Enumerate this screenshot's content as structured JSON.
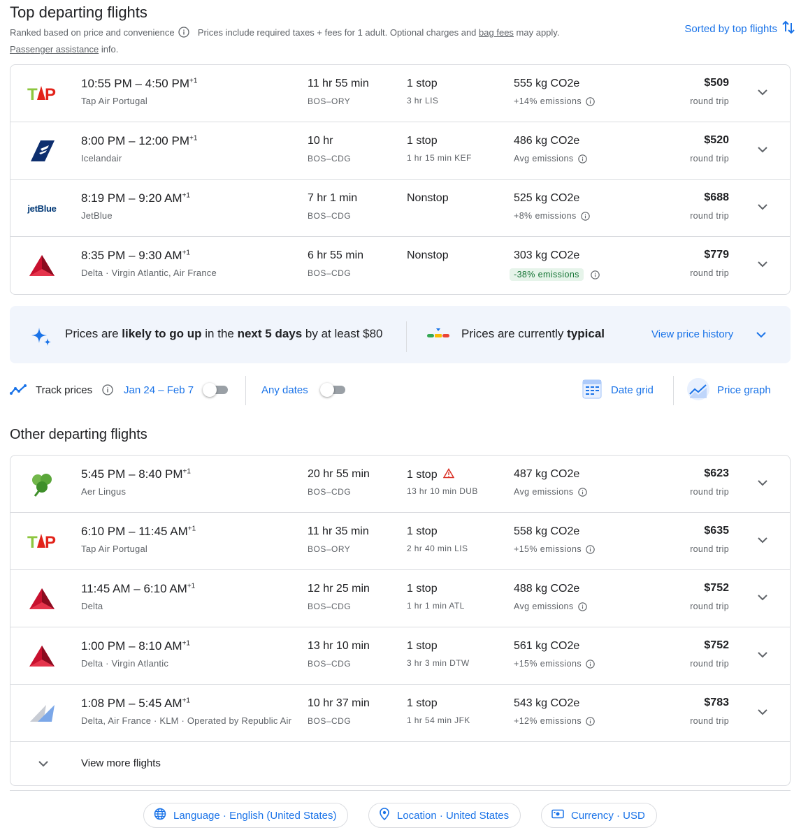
{
  "top": {
    "title": "Top departing flights",
    "ranked_text": "Ranked based on price and convenience",
    "prices_text": "Prices include required taxes + fees for 1 adult. Optional charges and",
    "bag_fees": "bag fees",
    "may_apply": "may apply.",
    "passenger_assistance": "Passenger assistance",
    "info_text": "info.",
    "sort_label": "Sorted by top flights"
  },
  "top_flights": [
    {
      "logo": "tap",
      "times": "10:55 PM – 4:50 PM",
      "plus": "+1",
      "airline": "Tap Air Portugal",
      "duration": "11 hr 55 min",
      "route": "BOS–ORY",
      "stops": "1 stop",
      "stop_info": "3 hr LIS",
      "co2": "555 kg CO2e",
      "emissions": "+14% emissions",
      "price": "$509",
      "trip": "round trip"
    },
    {
      "logo": "icelandair",
      "times": "8:00 PM – 12:00 PM",
      "plus": "+1",
      "airline": "Icelandair",
      "duration": "10 hr",
      "route": "BOS–CDG",
      "stops": "1 stop",
      "stop_info": "1 hr 15 min KEF",
      "co2": "486 kg CO2e",
      "emissions": "Avg emissions",
      "price": "$520",
      "trip": "round trip"
    },
    {
      "logo": "jetblue",
      "logo_text": "jetBlue",
      "times": "8:19 PM – 9:20 AM",
      "plus": "+1",
      "airline": "JetBlue",
      "duration": "7 hr 1 min",
      "route": "BOS–CDG",
      "stops": "Nonstop",
      "stop_info": "",
      "co2": "525 kg CO2e",
      "emissions": "+8% emissions",
      "price": "$688",
      "trip": "round trip"
    },
    {
      "logo": "delta",
      "times": "8:35 PM – 9:30 AM",
      "plus": "+1",
      "airline": "Delta · Virgin Atlantic, Air France",
      "duration": "6 hr 55 min",
      "route": "BOS–CDG",
      "stops": "Nonstop",
      "stop_info": "",
      "co2": "303 kg CO2e",
      "emissions": "-38% emissions",
      "green": true,
      "price": "$779",
      "trip": "round trip"
    }
  ],
  "insight": {
    "prefix": "Prices are ",
    "likely": "likely to go up",
    "mid": " in the ",
    "days": "next 5 days",
    "suffix": " by at least $80",
    "current_prefix": "Prices are currently ",
    "current_value": "typical",
    "history_link": "View price history"
  },
  "tracker": {
    "track_label": "Track prices",
    "dates": "Jan 24 – Feb 7",
    "any_dates": "Any dates",
    "date_grid": "Date grid",
    "price_graph": "Price graph"
  },
  "other": {
    "title": "Other departing flights",
    "view_more": "View more flights"
  },
  "other_flights": [
    {
      "logo": "aerlingus",
      "times": "5:45 PM – 8:40 PM",
      "plus": "+1",
      "airline": "Aer Lingus",
      "duration": "20 hr 55 min",
      "route": "BOS–CDG",
      "stops": "1 stop",
      "warning": true,
      "stop_info": "13 hr 10 min DUB",
      "co2": "487 kg CO2e",
      "emissions": "Avg emissions",
      "price": "$623",
      "trip": "round trip"
    },
    {
      "logo": "tap",
      "times": "6:10 PM – 11:45 AM",
      "plus": "+1",
      "airline": "Tap Air Portugal",
      "duration": "11 hr 35 min",
      "route": "BOS–ORY",
      "stops": "1 stop",
      "stop_info": "2 hr 40 min LIS",
      "co2": "558 kg CO2e",
      "emissions": "+15% emissions",
      "price": "$635",
      "trip": "round trip"
    },
    {
      "logo": "delta",
      "times": "11:45 AM – 6:10 AM",
      "plus": "+1",
      "airline": "Delta",
      "duration": "12 hr 25 min",
      "route": "BOS–CDG",
      "stops": "1 stop",
      "stop_info": "1 hr 1 min ATL",
      "co2": "488 kg CO2e",
      "emissions": "Avg emissions",
      "price": "$752",
      "trip": "round trip"
    },
    {
      "logo": "delta",
      "times": "1:00 PM – 8:10 AM",
      "plus": "+1",
      "airline": "Delta · Virgin Atlantic",
      "duration": "13 hr 10 min",
      "route": "BOS–CDG",
      "stops": "1 stop",
      "stop_info": "3 hr 3 min DTW",
      "co2": "561 kg CO2e",
      "emissions": "+15% emissions",
      "price": "$752",
      "trip": "round trip"
    },
    {
      "logo": "multi",
      "times": "1:08 PM – 5:45 AM",
      "plus": "+1",
      "airline": "Delta, Air France · KLM · Operated by Republic Air",
      "duration": "10 hr 37 min",
      "route": "BOS–CDG",
      "stops": "1 stop",
      "stop_info": "1 hr 54 min JFK",
      "co2": "543 kg CO2e",
      "emissions": "+12% emissions",
      "price": "$783",
      "trip": "round trip"
    }
  ],
  "footer": {
    "language": "Language · English (United States)",
    "location": "Location · United States",
    "currency": "Currency · USD"
  },
  "colors": {
    "accent": "#1a73e8",
    "green_bg": "#e6f4ea",
    "green_text": "#137333",
    "warning": "#d93025"
  }
}
